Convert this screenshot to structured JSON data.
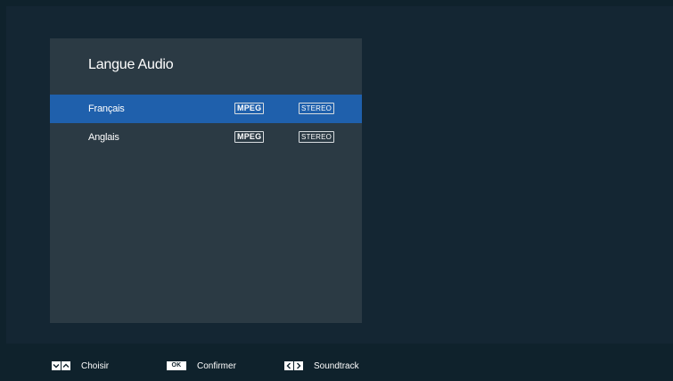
{
  "panel": {
    "title": "Langue Audio"
  },
  "tracks": [
    {
      "name": "Français",
      "codec": "MPEG",
      "channels": "STEREO",
      "selected": true
    },
    {
      "name": "Anglais",
      "codec": "MPEG",
      "channels": "STEREO",
      "selected": false
    }
  ],
  "footer": {
    "choose": {
      "label": "Choisir",
      "keys": [
        "chevron-down-icon",
        "chevron-up-icon"
      ]
    },
    "confirm": {
      "label": "Confirmer",
      "key": "OK"
    },
    "soundtrack": {
      "label": "Soundtrack",
      "keys": [
        "chevron-left-icon",
        "chevron-right-icon"
      ]
    }
  },
  "colors": {
    "background": "#0f222c",
    "screen": "#142633",
    "panel": "#2b3a44",
    "selection": "#1f60ac"
  }
}
